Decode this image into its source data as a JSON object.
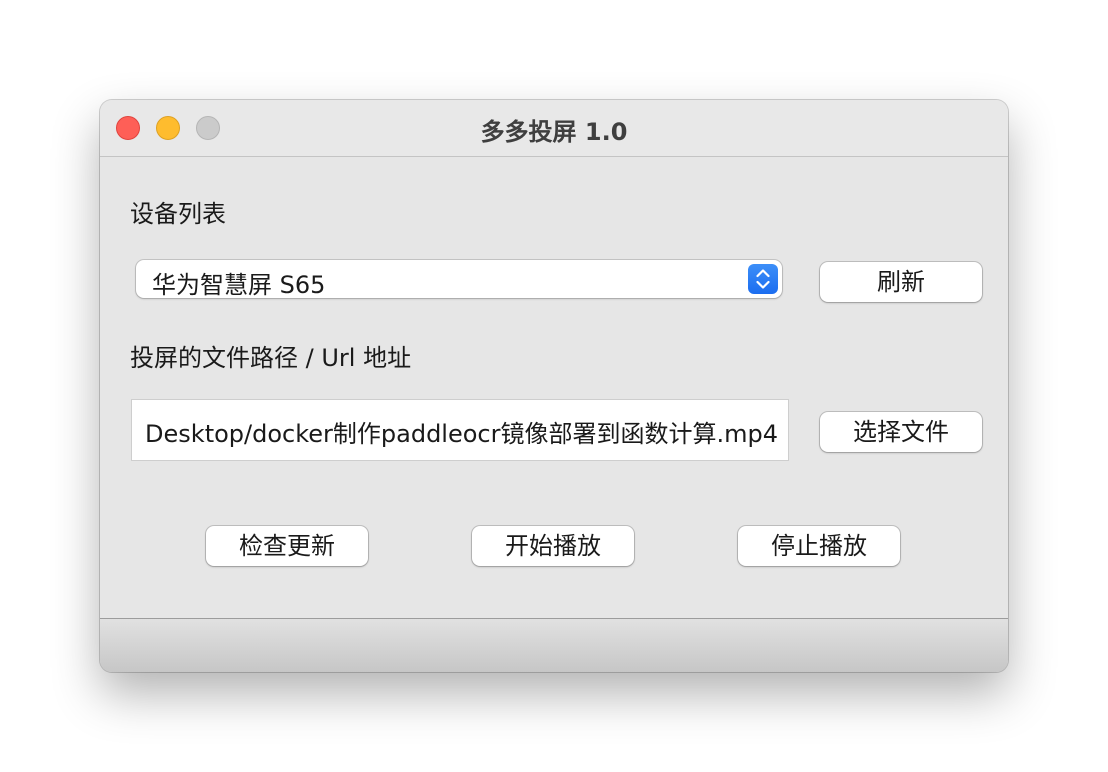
{
  "window": {
    "title": "多多投屏 1.0"
  },
  "devices": {
    "label": "设备列表",
    "selected": "华为智慧屏 S65",
    "refresh_label": "刷新"
  },
  "path": {
    "label": "投屏的文件路径 / Url 地址",
    "value": "Desktop/docker制作paddleocr镜像部署到函数计算.mp4",
    "choose_label": "选择文件"
  },
  "actions": {
    "check_update_label": "检查更新",
    "start_label": "开始播放",
    "stop_label": "停止播放"
  },
  "colors": {
    "close": "#fe5f57",
    "minimize": "#febc2e",
    "maximize": "#cbcbcb",
    "accent": "#1b6df0"
  }
}
